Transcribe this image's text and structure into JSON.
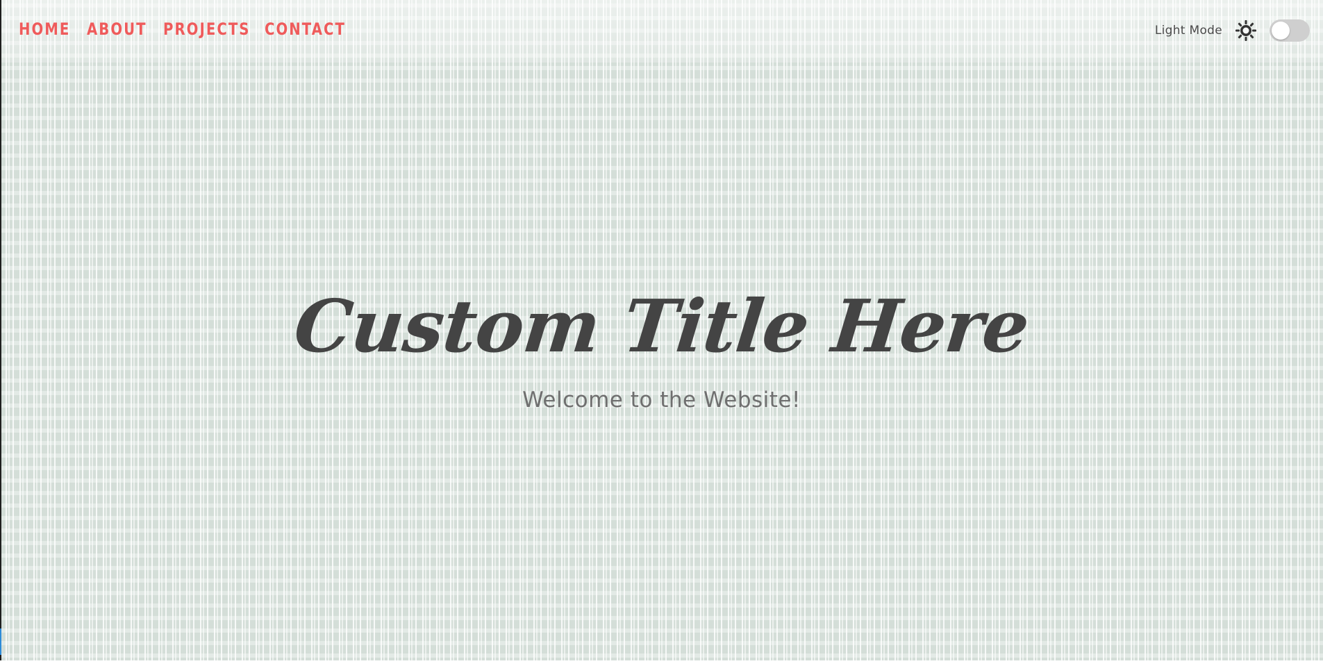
{
  "nav": {
    "links": [
      {
        "label": "HOME"
      },
      {
        "label": "ABOUT"
      },
      {
        "label": "PROJECTS"
      },
      {
        "label": "CONTACT"
      }
    ]
  },
  "theme_toggle": {
    "label": "Light Mode",
    "icon": "sun-icon",
    "state": "off"
  },
  "hero": {
    "title": "Custom Title Here",
    "subtitle": "Welcome to the Website!"
  },
  "colors": {
    "nav_link": "#ef5b5b",
    "title": "#444444",
    "subtitle": "#6f6f6f",
    "background_pattern": "#d4ded8",
    "toggle_track": "#cfcfcf"
  }
}
